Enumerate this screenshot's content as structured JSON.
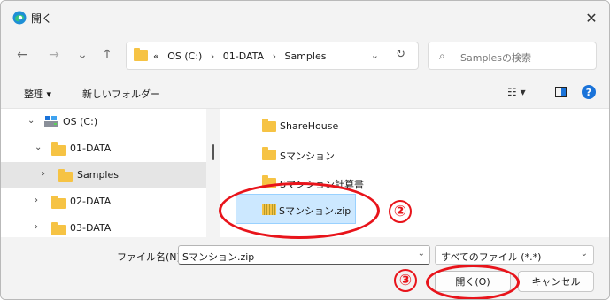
{
  "window": {
    "title": "開く",
    "close_glyph": "✕"
  },
  "nav": {
    "back_glyph": "←",
    "forward_glyph": "→",
    "recent_glyph": "⌄",
    "up_glyph": "↑",
    "address": {
      "overflow": "«",
      "crumbs": [
        "OS (C:)",
        "01-DATA",
        "Samples"
      ],
      "separator": "›",
      "dropdown_glyph": "⌄",
      "refresh_glyph": "↻"
    },
    "search": {
      "icon_glyph": "⌕",
      "placeholder": "Samplesの検索"
    }
  },
  "toolbar": {
    "organize": "整理 ▾",
    "new_folder": "新しいフォルダー",
    "view_glyph": "☷ ▾",
    "help_glyph": "?"
  },
  "tree": [
    {
      "label": "OS (C:)",
      "icon": "drive-icon",
      "arrow": "⌄"
    },
    {
      "label": "01-DATA",
      "icon": "folder-icon",
      "arrow": "⌄"
    },
    {
      "label": "Samples",
      "icon": "folder-icon",
      "arrow": "›",
      "selected": true
    },
    {
      "label": "02-DATA",
      "icon": "folder-icon",
      "arrow": "›"
    },
    {
      "label": "03-DATA",
      "icon": "folder-icon",
      "arrow": "›"
    }
  ],
  "files": [
    {
      "name": "ShareHouse",
      "icon": "folder-icon"
    },
    {
      "name": "Sマンション",
      "icon": "folder-icon"
    },
    {
      "name": "Sマンション計算書",
      "icon": "folder-icon"
    },
    {
      "name": "Sマンション.zip",
      "icon": "zip-folder-icon",
      "selected": true
    }
  ],
  "bottom": {
    "filename_label": "ファイル名(N):",
    "filename_value": "Sマンション.zip",
    "filetype_value": "すべてのファイル (*.*)",
    "dropdown_glyph": "⌄",
    "open_label": "開く(O)",
    "cancel_label": "キャンセル"
  },
  "annotations": {
    "step2": "②",
    "step3": "③",
    "color": "#e8141b"
  },
  "colors": {
    "accent": "#1a73d9",
    "folder": "#f6c344",
    "selection": "#cce8ff"
  }
}
